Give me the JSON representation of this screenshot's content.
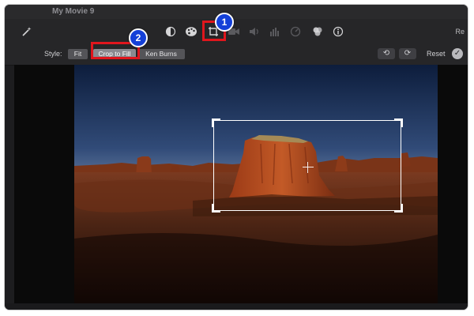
{
  "window": {
    "title": "My Movie 9"
  },
  "toolbar": {
    "tools": [
      {
        "name": "magic-wand-icon",
        "active": true
      },
      {
        "name": "color-balance-icon",
        "active": true
      },
      {
        "name": "color-palette-icon",
        "active": true
      },
      {
        "name": "crop-icon",
        "active": true
      },
      {
        "name": "video-camera-icon",
        "active": false
      },
      {
        "name": "volume-icon",
        "active": false
      },
      {
        "name": "equalizer-icon",
        "active": false
      },
      {
        "name": "speedometer-icon",
        "active": false
      },
      {
        "name": "filter-icon",
        "active": true
      },
      {
        "name": "info-icon",
        "active": true
      }
    ],
    "right_label": "Re"
  },
  "style_bar": {
    "label": "Style:",
    "options": [
      "Fit",
      "Crop to Fill",
      "Ken Burns"
    ],
    "selected": "Crop to Fill",
    "rotate_left_icon": "rotate-left-icon",
    "rotate_right_icon": "rotate-right-icon",
    "reset_label": "Reset",
    "apply_icon": "checkmark-icon"
  },
  "annotations": [
    {
      "number": "1",
      "target": "crop-icon"
    },
    {
      "number": "2",
      "target": "Crop to Fill"
    }
  ],
  "colors": {
    "annotation_red": "#e0161d",
    "annotation_blue": "#1440d8",
    "crop_frame": "#ffffff"
  }
}
